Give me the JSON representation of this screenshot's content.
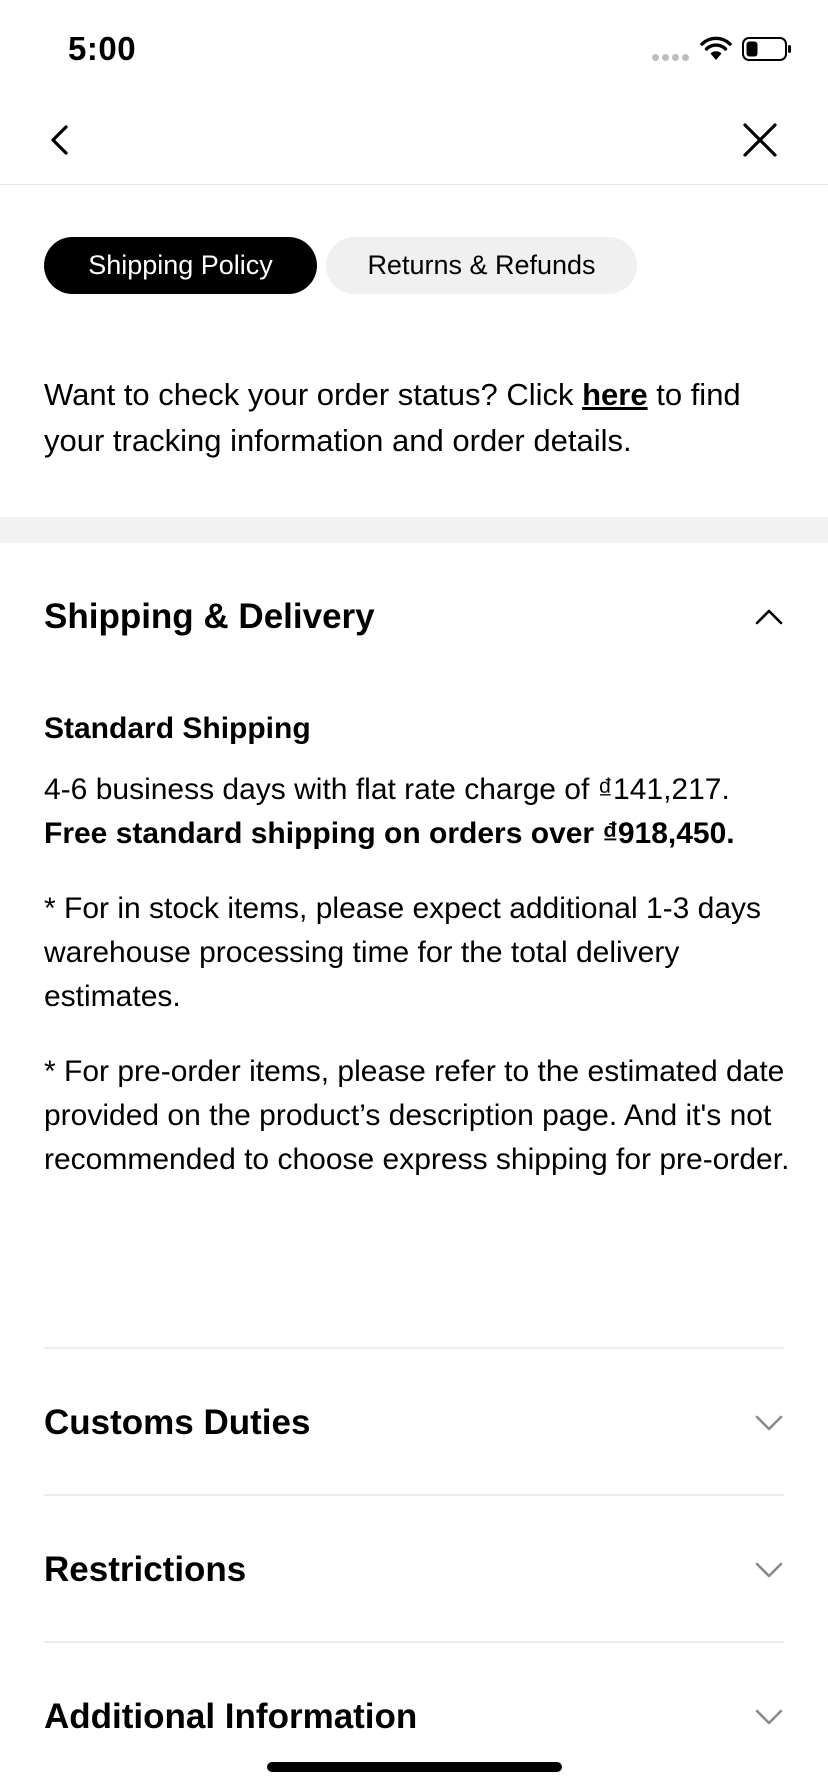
{
  "status": {
    "time": "5:00"
  },
  "tabs": [
    {
      "label": "Shipping Policy"
    },
    {
      "label": "Returns & Refunds"
    }
  ],
  "intro": {
    "prefix": "Want to check your order status? Click ",
    "link": "here",
    "suffix": " to find your tracking information and order details."
  },
  "sections": {
    "shipping": {
      "title": "Shipping & Delivery",
      "subtitle": "Standard Shipping",
      "p1_normal": "4-6 business days with flat rate charge of ₫141,217. ",
      "p1_bold": "Free standard shipping on orders over ₫918,450.",
      "p2": "* For in stock items, please expect additional 1-3 days warehouse processing time for the total delivery estimates.",
      "p3": "* For pre-order items, please refer to the estimated date provided on the product’s description page. And it's not recommended to choose express shipping for pre-order."
    },
    "customs": {
      "title": "Customs Duties"
    },
    "restrictions": {
      "title": "Restrictions"
    },
    "additional": {
      "title": "Additional Information"
    }
  }
}
